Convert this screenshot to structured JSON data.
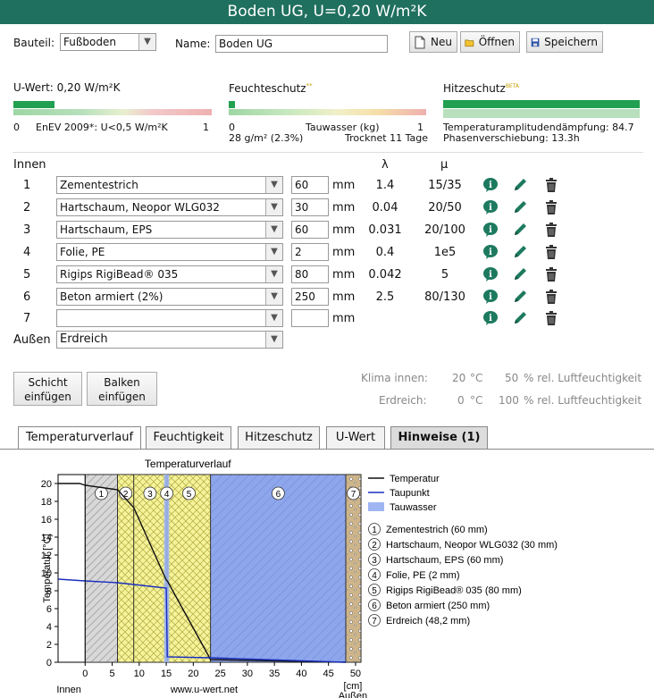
{
  "title": "Boden UG, U=0,20 W/m²K",
  "toolbar": {
    "bauteil_label": "Bauteil:",
    "bauteil_value": "Fußboden",
    "name_label": "Name:",
    "name_value": "Boden UG",
    "neu": "Neu",
    "oeffnen": "Öffnen",
    "speichern": "Speichern"
  },
  "uwert": {
    "title": "U-Wert: 0,20 W/m²K",
    "scale_min": "0",
    "enev": "EnEV 2009*: U<0,5 W/m²K",
    "scale_max": "1",
    "level": 0.2
  },
  "feuchte": {
    "title": "Feuchteschutz",
    "sup": "**",
    "scale_min": "0",
    "tauwasser": "Tauwasser (kg)",
    "scale_max": "1",
    "amount": "28 g/m² (2.3%)",
    "trocknet": "Trocknet 11 Tage"
  },
  "hitze": {
    "title": "Hitzeschutz",
    "sup": "BETA",
    "daempfung": "Temperaturamplitudendämpfung: 84.7",
    "phase": "Phasenverschiebung: 13.3h"
  },
  "table": {
    "innen": "Innen",
    "lambda": "λ",
    "mu": "μ",
    "unit": "mm",
    "aussen": "Außen",
    "aussen_value": "Erdreich",
    "layers": [
      {
        "n": "1",
        "material": "Zementestrich",
        "thick": "60",
        "lambda": "1.4",
        "mu": "15/35"
      },
      {
        "n": "2",
        "material": "Hartschaum, Neopor WLG032",
        "thick": "30",
        "lambda": "0.04",
        "mu": "20/50"
      },
      {
        "n": "3",
        "material": "Hartschaum, EPS",
        "thick": "60",
        "lambda": "0.031",
        "mu": "20/100"
      },
      {
        "n": "4",
        "material": "Folie, PE",
        "thick": "2",
        "lambda": "0.4",
        "mu": "1e5"
      },
      {
        "n": "5",
        "material": "Rigips RigiBead® 035",
        "thick": "80",
        "lambda": "0.042",
        "mu": "5"
      },
      {
        "n": "6",
        "material": "Beton armiert (2%)",
        "thick": "250",
        "lambda": "2.5",
        "mu": "80/130"
      },
      {
        "n": "7",
        "material": "",
        "thick": "",
        "lambda": "",
        "mu": ""
      }
    ]
  },
  "buttons": {
    "schicht": [
      "Schicht",
      "einfügen"
    ],
    "balken": [
      "Balken",
      "einfügen"
    ]
  },
  "klima": {
    "innen_label": "Klima innen:",
    "innen_temp": "20",
    "innen_unit": "°C",
    "innen_hum": "50",
    "innen_hum_unit": "% rel. Luftfeuchtigkeit",
    "erd_label": "Erdreich:",
    "erd_temp": "0",
    "erd_unit": "°C",
    "erd_hum": "100",
    "erd_hum_unit": "% rel. Luftfeuchtigkeit"
  },
  "tabs": [
    "Temperaturverlauf",
    "Feuchtigkeit",
    "Hitzeschutz",
    "U-Wert",
    "Hinweise (1)"
  ],
  "chart_data": {
    "type": "line",
    "title": "Temperaturverlauf",
    "xlabel": "[cm]",
    "ylabel": "Temperatur [°C]",
    "x_ticks": [
      "0",
      "5",
      "10",
      "15",
      "20",
      "25",
      "30",
      "35",
      "40",
      "45",
      "50"
    ],
    "y_ticks": [
      "0",
      "2",
      "4",
      "6",
      "8",
      "10",
      "12",
      "14",
      "16",
      "18",
      "20"
    ],
    "xlim": [
      -5,
      51
    ],
    "ylim": [
      0,
      21
    ],
    "left_label": "Innen",
    "right_label": "Außen",
    "source": "www.u-wert.net",
    "legend": [
      "Temperatur",
      "Taupunkt",
      "Tauwasser"
    ],
    "layer_legend": [
      "Zementestrich (60 mm)",
      "Hartschaum, Neopor WLG032 (30 mm)",
      "Hartschaum, EPS (60 mm)",
      "Folie, PE (2 mm)",
      "Rigips RigiBead® 035 (80 mm)",
      "Beton armiert (250 mm)",
      "Erdreich (48,2 mm)"
    ],
    "layer_numbers": [
      "1",
      "2",
      "3",
      "4",
      "5",
      "6",
      "7"
    ],
    "layer_bounds_cm": [
      0,
      6,
      9,
      15,
      15.2,
      23.2,
      48.2,
      51
    ],
    "series": [
      {
        "name": "Temperatur",
        "x": [
          -5,
          -1,
          0,
          6,
          9,
          15,
          15.2,
          23.2,
          48.2
        ],
        "y": [
          20,
          20,
          19.8,
          19.3,
          17.3,
          9.2,
          9.1,
          0.3,
          0
        ]
      },
      {
        "name": "Taupunkt",
        "x": [
          -5,
          0,
          6,
          9,
          15,
          15.2,
          23.2,
          48.2
        ],
        "y": [
          9.3,
          9.1,
          8.9,
          8.7,
          8.3,
          0.6,
          0.5,
          0
        ]
      }
    ],
    "tauwasser_band_cm": [
      14.6,
      15.2
    ],
    "colors": {
      "temperatur": "#111111",
      "taupunkt": "#1a2fbf",
      "tauwasser": "#9fb6f2"
    }
  }
}
